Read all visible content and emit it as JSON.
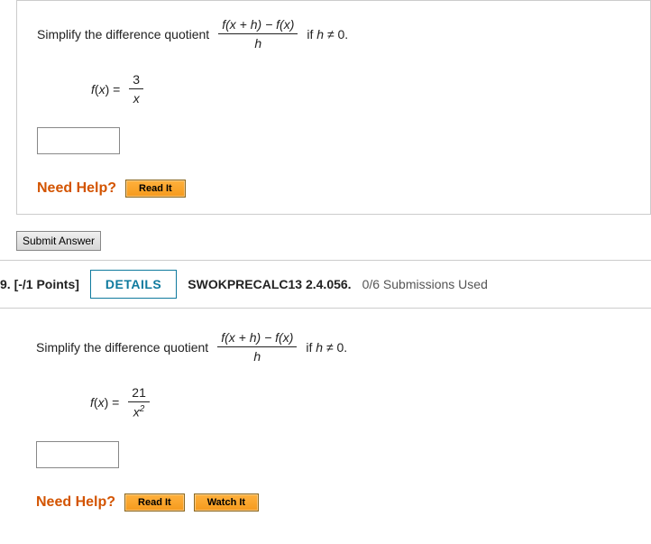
{
  "q1": {
    "prompt_lead": "Simplify the difference quotient",
    "dq_num_a": "f",
    "dq_num_b": "(",
    "dq_num_c": "x",
    "dq_num_d": " + ",
    "dq_num_e": "h",
    "dq_num_f": ") − ",
    "dq_num_g": "f",
    "dq_num_h": "(",
    "dq_num_i": "x",
    "dq_num_j": ")",
    "dq_den": "h",
    "cond_a": " if ",
    "cond_b": "h",
    "cond_c": " ≠ 0.",
    "func_lhs_a": "f",
    "func_lhs_b": "(",
    "func_lhs_c": "x",
    "func_lhs_d": ") = ",
    "func_num": "3",
    "func_den": "x",
    "need_help": "Need Help?",
    "read_it": "Read It"
  },
  "submit": "Submit Answer",
  "header": {
    "qnum": "9.",
    "points": "[-/1 Points]",
    "details": "DETAILS",
    "ref": "SWOKPRECALC13 2.4.056.",
    "subs": "0/6 Submissions Used"
  },
  "q2": {
    "prompt_lead": "Simplify the difference quotient",
    "dq_num_a": "f",
    "dq_num_b": "(",
    "dq_num_c": "x",
    "dq_num_d": " + ",
    "dq_num_e": "h",
    "dq_num_f": ") − ",
    "dq_num_g": "f",
    "dq_num_h": "(",
    "dq_num_i": "x",
    "dq_num_j": ")",
    "dq_den": "h",
    "cond_a": " if ",
    "cond_b": "h",
    "cond_c": " ≠ 0.",
    "func_lhs_a": "f",
    "func_lhs_b": "(",
    "func_lhs_c": "x",
    "func_lhs_d": ") = ",
    "func_num": "21",
    "func_den_base": "x",
    "func_den_exp": "2",
    "need_help": "Need Help?",
    "read_it": "Read It",
    "watch_it": "Watch It"
  }
}
